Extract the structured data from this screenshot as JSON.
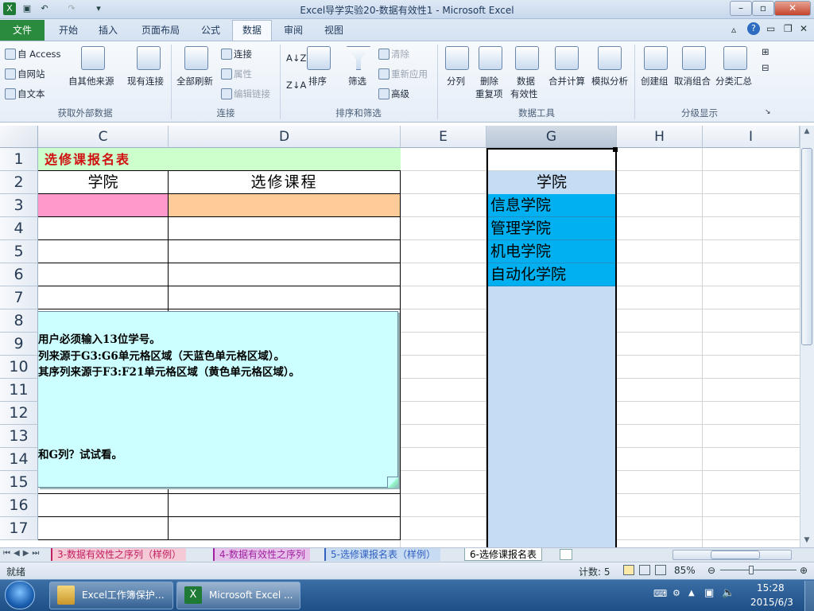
{
  "window": {
    "title": "Excel导学实验20-数据有效性1 - Microsoft Excel"
  },
  "ribbon_tabs": [
    "文件",
    "开始",
    "插入",
    "页面布局",
    "公式",
    "数据",
    "审阅",
    "视图"
  ],
  "ribbon": {
    "get_external": {
      "access": "自 Access",
      "web": "自网站",
      "text": "自文本",
      "other": "自其他来源",
      "existing": "现有连接",
      "group": "获取外部数据"
    },
    "connections": {
      "refresh": "全部刷新",
      "connect": "连接",
      "props": "属性",
      "edit_links": "编辑链接",
      "group": "连接"
    },
    "sort_filter": {
      "sort": "排序",
      "filter": "筛选",
      "clear": "清除",
      "reapply": "重新应用",
      "advanced": "高级",
      "group": "排序和筛选"
    },
    "data_tools": {
      "split": "分列",
      "remove_dup_1": "删除",
      "remove_dup_2": "重复项",
      "validation_1": "数据",
      "validation_2": "有效性",
      "consolidate": "合并计算",
      "what_if": "模拟分析",
      "group": "数据工具"
    },
    "outline": {
      "group_btn": "创建组",
      "ungroup": "取消组合",
      "subtotal": "分类汇总",
      "group": "分级显示"
    }
  },
  "columns": [
    "C",
    "D",
    "E",
    "G",
    "H",
    "I"
  ],
  "rows": [
    "1",
    "2",
    "3",
    "4",
    "5",
    "6",
    "7",
    "8",
    "9",
    "10",
    "11",
    "12",
    "13",
    "14",
    "15",
    "16",
    "17"
  ],
  "sheet": {
    "title": "选修课报名表",
    "header_college": "学院",
    "header_course": "选修课程",
    "list_header": "学院",
    "colleges": [
      "信息学院",
      "管理学院",
      "机电学院",
      "自动化学院"
    ]
  },
  "note_box": {
    "line1": "用户必须输入13位学号。",
    "line2": "列来源于G3:G6单元格区域（天蓝色单元格区域）。",
    "line3": "其序列来源于F3:F21单元格区域（黄色单元格区域）。",
    "line4": "和G列？试试看。"
  },
  "sheet_tabs": [
    "3-数据有效性之序列（样例）",
    "4-数据有效性之序列",
    "5-选修课报名表（样例）",
    "6-选修课报名表"
  ],
  "status": {
    "ready": "就绪",
    "count": "计数: 5",
    "zoom": "85%"
  },
  "taskbar": {
    "item1": "Excel工作簿保护…",
    "item2": "Microsoft Excel ...",
    "time": "15:28",
    "date": "2015/6/3"
  },
  "colors": {
    "green_title": "#ccffcc",
    "pink": "#ff99cc",
    "orange": "#ffcc99",
    "light_blue": "#c5dcf5",
    "sky_blue": "#00b0f0",
    "note": "#ccffff"
  }
}
